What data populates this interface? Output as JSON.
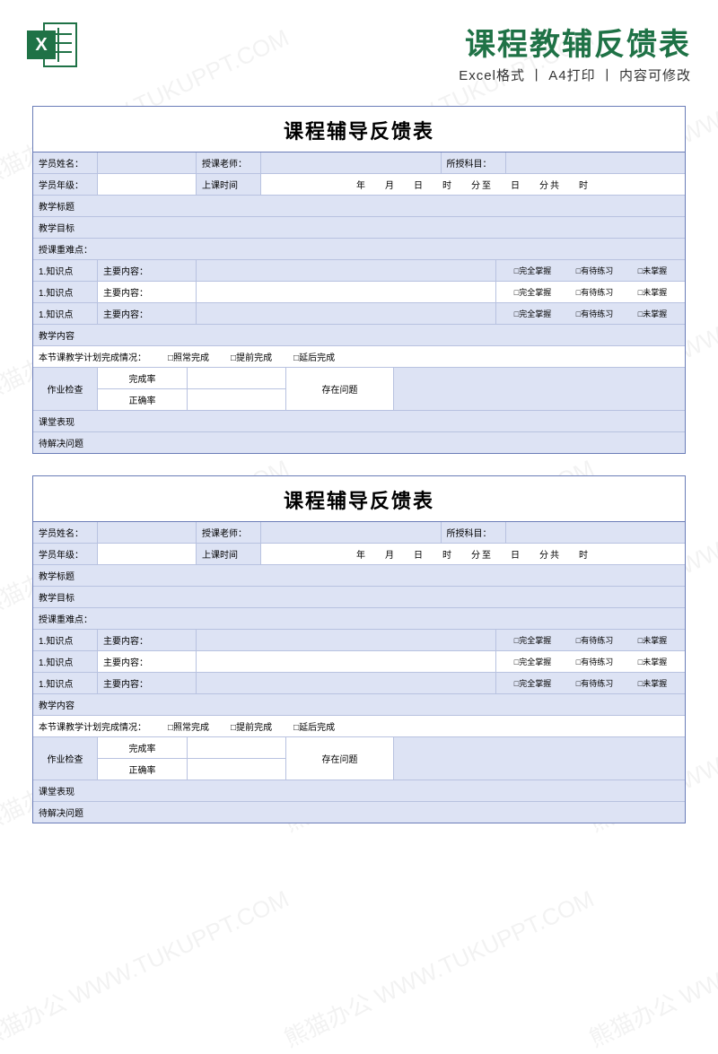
{
  "header": {
    "title": "课程教辅反馈表",
    "subtitle": "Excel格式 丨 A4打印 丨 内容可修改",
    "icon_letter": "X"
  },
  "watermark": "熊猫办公 WWW.TUKUPPT.COM",
  "form": {
    "title": "课程辅导反馈表",
    "labels": {
      "student_name": "学员姓名：",
      "teacher": "授课老师：",
      "subject": "所授科目：",
      "grade": "学员年级：",
      "class_time": "上课时间",
      "year": "年",
      "month": "月",
      "day": "日",
      "hour": "时",
      "min_to": "分至",
      "day2": "日",
      "min_total": "分共",
      "hour2": "时",
      "teach_title": "教学标题",
      "teach_goal": "教学目标",
      "key_points": "授课重难点：",
      "kp1": "1.知识点",
      "kp2": "1.知识点",
      "kp3": "1.知识点",
      "main_content": "主要内容：",
      "mastered": "□完全掌握",
      "need_practice": "□有待练习",
      "not_mastered": "□未掌握",
      "teach_content": "教学内容",
      "completion_header": "本节课教学计划完成情况：",
      "comp_normal": "□照常完成",
      "comp_early": "□提前完成",
      "comp_late": "□延后完成",
      "hw_check": "作业检查",
      "completion_rate": "完成率",
      "accuracy_rate": "正确率",
      "issues": "存在问题",
      "class_perf": "课堂表现",
      "pending": "待解决问题"
    }
  }
}
